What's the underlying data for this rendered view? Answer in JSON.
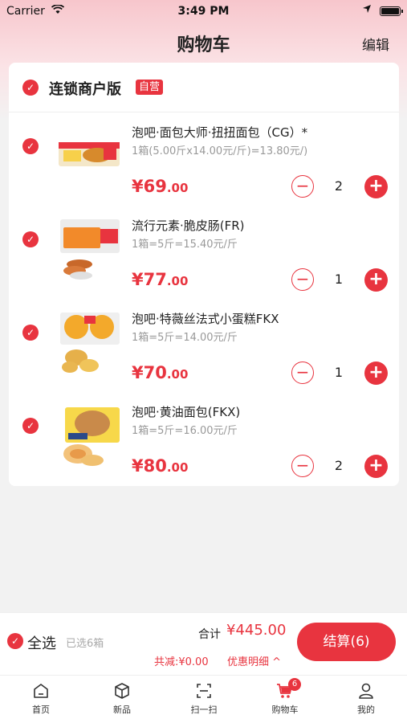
{
  "status_bar": {
    "carrier": "Carrier",
    "time": "3:49 PM"
  },
  "nav": {
    "title": "购物车",
    "edit_label": "编辑"
  },
  "store": {
    "name": "连锁商户版",
    "badge": "自营"
  },
  "items": [
    {
      "name": "泡吧·面包大师·扭扭面包（CG）*",
      "spec": "1箱(5.00斤x14.00元/斤)=13.80元/)",
      "price_int": "¥69",
      "price_dec": ".00",
      "quantity": "2"
    },
    {
      "name": "流行元素·脆皮肠(FR)",
      "spec": "1箱=5斤=15.40元/斤",
      "price_int": "¥77",
      "price_dec": ".00",
      "quantity": "1"
    },
    {
      "name": "泡吧·特薇丝法式小蛋糕FKX",
      "spec": "1箱=5斤=14.00元/斤",
      "price_int": "¥70",
      "price_dec": ".00",
      "quantity": "1"
    },
    {
      "name": "泡吧·黄油面包(FKX)",
      "spec": "1箱=5斤=16.00元/斤",
      "price_int": "¥80",
      "price_dec": ".00",
      "quantity": "2"
    }
  ],
  "checkout": {
    "select_all": "全选",
    "selected_count": "已选6箱",
    "total_label": "合计",
    "total_value": "¥445.00",
    "discount": "共减:¥0.00",
    "detail": "优惠明细 ^",
    "pay_button": "结算(6)"
  },
  "tabbar": {
    "tabs": [
      {
        "label": "首页",
        "icon": "home-icon"
      },
      {
        "label": "新品",
        "icon": "box-icon"
      },
      {
        "label": "扫一扫",
        "icon": "scan-icon"
      },
      {
        "label": "购物车",
        "icon": "cart-icon",
        "badge": "6"
      },
      {
        "label": "我的",
        "icon": "user-icon"
      }
    ]
  },
  "colors": {
    "accent": "#e8343f",
    "header_gradient": "#f7c6cc"
  }
}
